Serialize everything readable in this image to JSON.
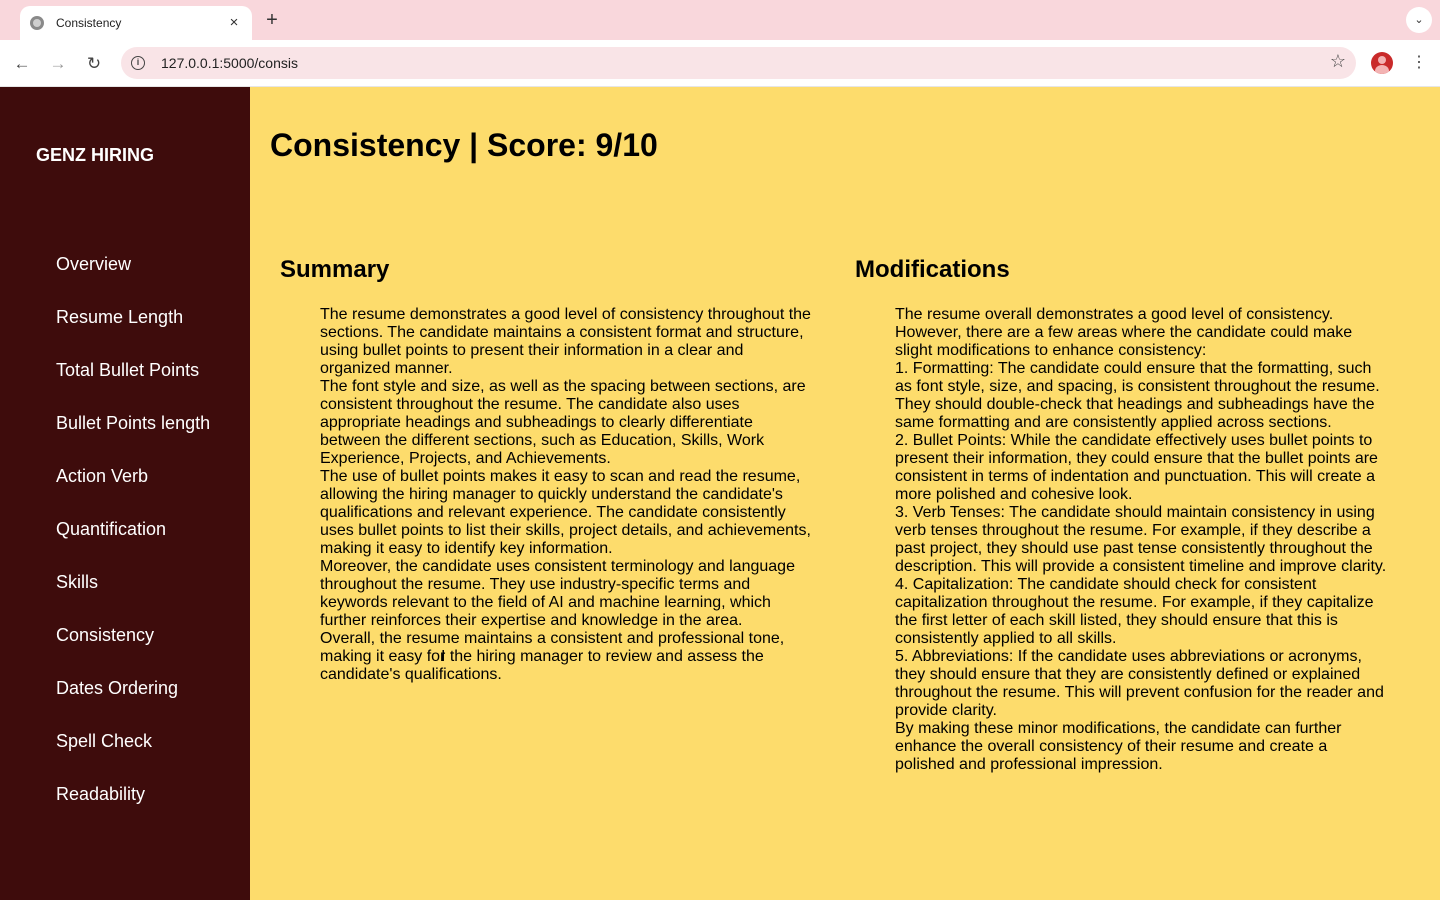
{
  "browser": {
    "tab_title": "Consistency",
    "tab_close": "×",
    "new_tab": "+",
    "tab_menu": "⌄",
    "back": "←",
    "forward": "→",
    "reload": "↻",
    "info": "i",
    "url": "127.0.0.1:5000/consis",
    "star": "☆",
    "menu": "⋮"
  },
  "sidebar": {
    "brand": "GENZ HIRING",
    "items": [
      {
        "label": "Overview"
      },
      {
        "label": "Resume Length"
      },
      {
        "label": "Total Bullet Points"
      },
      {
        "label": "Bullet Points length"
      },
      {
        "label": "Action Verb"
      },
      {
        "label": "Quantification"
      },
      {
        "label": "Skills"
      },
      {
        "label": "Consistency"
      },
      {
        "label": "Dates Ordering"
      },
      {
        "label": "Spell Check"
      },
      {
        "label": "Readability"
      }
    ]
  },
  "main": {
    "title": "Consistency | Score: 9/10",
    "summary": {
      "heading": "Summary",
      "lines": [
        "The resume demonstrates a good level of consistency throughout the",
        "sections. The candidate maintains a consistent format and structure,",
        "using bullet points to present their information in a clear and",
        "organized manner.",
        "The font style and size, as well as the spacing between sections, are",
        "consistent throughout the resume. The candidate also uses",
        "appropriate headings and subheadings to clearly differentiate",
        "between the different sections, such as Education, Skills, Work",
        "Experience, Projects, and Achievements.",
        "The use of bullet points makes it easy to scan and read the resume,",
        "allowing the hiring manager to quickly understand the candidate's",
        "qualifications and relevant experience. The candidate consistently",
        "uses bullet points to list their skills, project details, and achievements,",
        "making it easy to identify key information.",
        "Moreover, the candidate uses consistent terminology and language",
        "throughout the resume. They use industry-specific terms and",
        "keywords relevant to the field of AI and machine learning, which",
        "further reinforces their expertise and knowledge in the area.",
        "Overall, the resume maintains a consistent and professional tone,",
        "making it easy for the hiring manager to review and assess the",
        "candidate's qualifications."
      ]
    },
    "modifications": {
      "heading": "Modifications",
      "lines": [
        "The resume overall demonstrates a good level of consistency.",
        "However, there are a few areas where the candidate could make",
        "slight modifications to enhance consistency:",
        "1. Formatting: The candidate could ensure that the formatting, such",
        "as font style, size, and spacing, is consistent throughout the resume.",
        "They should double-check that headings and subheadings have the",
        "same formatting and are consistently applied across sections.",
        "2. Bullet Points: While the candidate effectively uses bullet points to",
        "present their information, they could ensure that the bullet points are",
        "consistent in terms of indentation and punctuation. This will create a",
        "more polished and cohesive look.",
        "3. Verb Tenses: The candidate should maintain consistency in using",
        "verb tenses throughout the resume. For example, if they describe a",
        "past project, they should use past tense consistently throughout the",
        "description. This will provide a consistent timeline and improve clarity.",
        "4. Capitalization: The candidate should check for consistent",
        "capitalization throughout the resume. For example, if they capitalize",
        "the first letter of each skill listed, they should ensure that this is",
        "consistently applied to all skills.",
        "5. Abbreviations: If the candidate uses abbreviations or acronyms,",
        "they should ensure that they are consistently defined or explained",
        "throughout the resume. This will prevent confusion for the reader and",
        "provide clarity.",
        "By making these minor modifications, the candidate can further",
        "enhance the overall consistency of their resume and create a",
        "polished and professional impression."
      ]
    }
  }
}
